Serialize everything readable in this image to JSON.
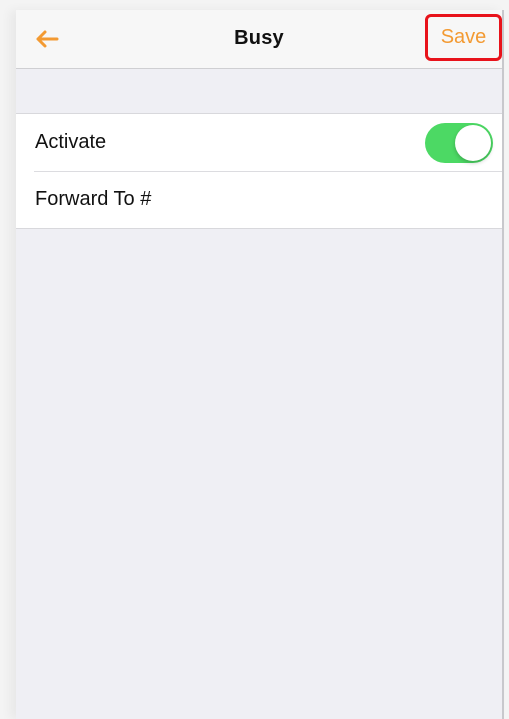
{
  "nav": {
    "title": "Busy",
    "save_label": "Save",
    "back_icon": "back-arrow-icon",
    "accent_color": "#f39a32",
    "highlight_color": "#e8131b"
  },
  "settings": {
    "activate_label": "Activate",
    "activate_state": "on",
    "forward_label": "Forward To #",
    "toggle_color": "#4cd964"
  }
}
